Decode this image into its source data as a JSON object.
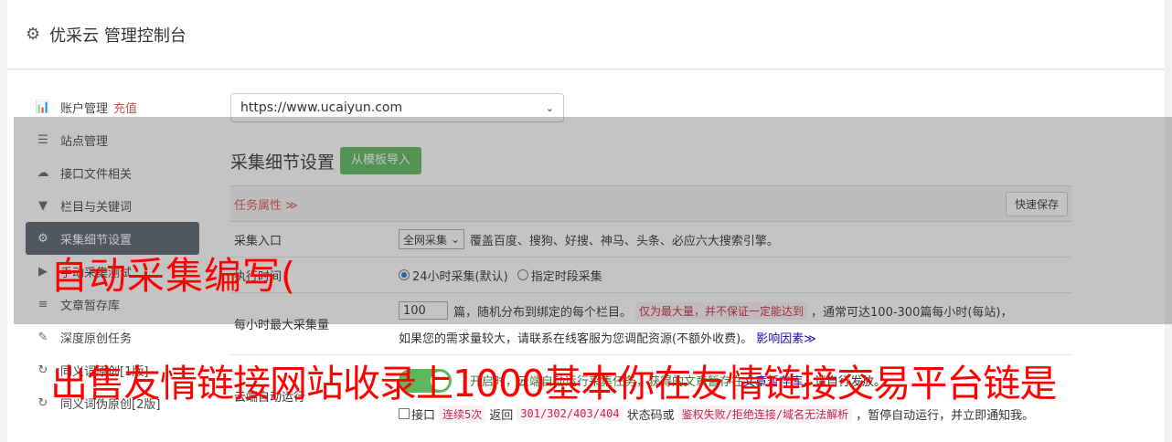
{
  "header": {
    "title": "优采云 管理控制台",
    "icon": "gear-icon"
  },
  "sidebar": {
    "items": [
      {
        "label": "账户管理",
        "extra": "充值",
        "icon": "bar-chart-icon",
        "glyph": "📊"
      },
      {
        "label": "站点管理",
        "icon": "server-icon",
        "glyph": "☰"
      },
      {
        "label": "接口文件相关",
        "icon": "cloud-upload-icon",
        "glyph": "☁"
      },
      {
        "label": "栏目与关键词",
        "icon": "filter-icon",
        "glyph": "▼"
      },
      {
        "label": "采集细节设置",
        "icon": "gears-icon",
        "glyph": "⚙"
      },
      {
        "label": "手动采集测试",
        "icon": "play-circle-icon",
        "glyph": "▶"
      },
      {
        "label": "文章暂存库",
        "icon": "database-icon",
        "glyph": "≡"
      },
      {
        "label": "深度原创任务",
        "icon": "edit-icon",
        "glyph": "✎"
      },
      {
        "label": "同义词原创[1版]",
        "icon": "refresh-icon",
        "glyph": "↻"
      },
      {
        "label": "同义词伪原创[2版]",
        "icon": "refresh-icon",
        "glyph": "↻"
      }
    ],
    "active_index": 4
  },
  "site_select": {
    "value": "https://www.ucaiyun.com"
  },
  "section": {
    "title": "采集细节设置",
    "import_button": "从模板导入"
  },
  "task_bar": {
    "label": "任务属性 ≫",
    "save_button": "快速保存"
  },
  "rows": {
    "entry": {
      "label": "采集入口",
      "select": "全网采集",
      "desc": "覆盖百度、搜狗、好搜、神马、头条、必应六大搜索引擎。"
    },
    "time": {
      "label": "执行时间",
      "opt1": "24小时采集(默认)",
      "opt2": "指定时段采集"
    },
    "max": {
      "label": "每小时最大采集量",
      "value": "100",
      "text1": "篇，随机分布到绑定的每个栏目。",
      "tag": "仅为最大量，并不保证一定能达到",
      "text2": "，通常可达100-300篇每小时(每站)，",
      "text3": "如果您的需求量较大，请联系在线客服为您调配资源(不额外收费)。",
      "link": "影响因素≫"
    },
    "cloud": {
      "label": "云端自动运行",
      "on_text": "开启时，云端自动运行采集任务，获得的文章暂存在",
      "link": "文章暂存库",
      "tail": "，请自行发放。",
      "check_label": "接口",
      "tag1": "连续5次",
      "mid1": "返回",
      "tag2": "301/302/403/404",
      "mid2": "状态码或",
      "tag3": "鉴权失败/拒绝连接/域名无法解析",
      "end": "，暂停自动运行，并立即通知我。"
    }
  },
  "overlay_text": {
    "line1": "自动采集编写(",
    "line2": "出售友情链接网站收录上1000基本你在友情链接交易平台链是"
  },
  "colors": {
    "accent_green": "#5cb85c",
    "active_bg": "#5b6470",
    "warning_red": "#d9534f",
    "overlay_red": "#ff0000"
  }
}
